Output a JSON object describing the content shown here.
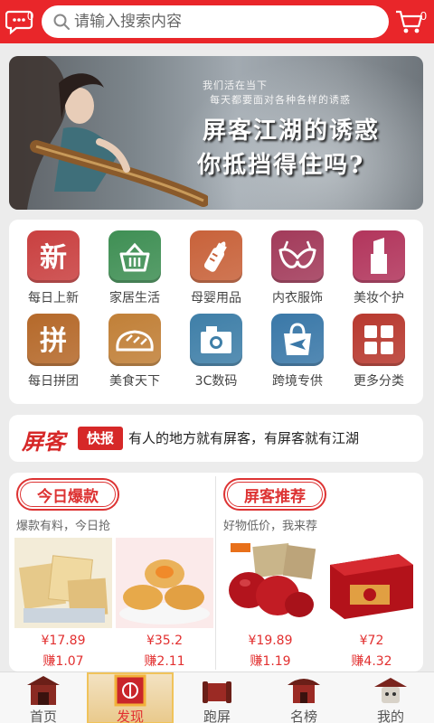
{
  "header": {
    "messages_badge": "0",
    "cart_badge": "0",
    "search_placeholder": "请输入搜索内容",
    "brand_color": "#e9262a"
  },
  "banner": {
    "small_line_1": "我们活在当下",
    "small_line_2": "每天都要面对各种各样的诱惑",
    "big_line_1": "屏客江湖的诱惑",
    "big_line_2": "你抵挡得住吗?"
  },
  "categories": [
    {
      "label": "每日上新",
      "icon": "new-glyph-icon",
      "color": "#c94040",
      "glyph": "新"
    },
    {
      "label": "家居生活",
      "icon": "basket-icon",
      "color": "#3f8f54"
    },
    {
      "label": "母婴用品",
      "icon": "baby-bottle-icon",
      "color": "#c8623a"
    },
    {
      "label": "内衣服饰",
      "icon": "bra-icon",
      "color": "#a23a5a"
    },
    {
      "label": "美妆个护",
      "icon": "lipstick-icon",
      "color": "#b2355c"
    },
    {
      "label": "每日拼团",
      "icon": "group-glyph-icon",
      "color": "#b5692a",
      "glyph": "拼"
    },
    {
      "label": "美食天下",
      "icon": "bread-icon",
      "color": "#c18038"
    },
    {
      "label": "3C数码",
      "icon": "camera-icon",
      "color": "#3f7fa8"
    },
    {
      "label": "跨境专供",
      "icon": "plane-bag-icon",
      "color": "#3a78a8"
    },
    {
      "label": "更多分类",
      "icon": "grid-icon",
      "color": "#b8392f"
    }
  ],
  "news": {
    "brand": "屏客",
    "tag": "快报",
    "text": "有人的地方就有屏客，有屏客就有江湖"
  },
  "promo": {
    "left": {
      "title": "今日爆款",
      "subtitle": "爆款有料，今日抢",
      "products": [
        {
          "price": "¥17.89",
          "earn": "赚1.07",
          "image": "biscuits"
        },
        {
          "price": "¥35.2",
          "earn": "赚2.11",
          "image": "pastries"
        }
      ]
    },
    "right": {
      "title": "屏客推荐",
      "subtitle": "好物低价，我来荐",
      "products": [
        {
          "price": "¥19.89",
          "earn": "赚1.19",
          "image": "red-dates"
        },
        {
          "price": "¥72",
          "earn": "赚4.32",
          "image": "gift-box"
        }
      ]
    }
  },
  "bottom_nav": [
    {
      "label": "首页",
      "icon": "home-gate-icon",
      "active": false
    },
    {
      "label": "发现",
      "icon": "discover-seal-icon",
      "active": true
    },
    {
      "label": "跑屏",
      "icon": "scroll-drum-icon",
      "active": false
    },
    {
      "label": "名榜",
      "icon": "pavilion-icon",
      "active": false
    },
    {
      "label": "我的",
      "icon": "profile-hat-icon",
      "active": false
    }
  ]
}
